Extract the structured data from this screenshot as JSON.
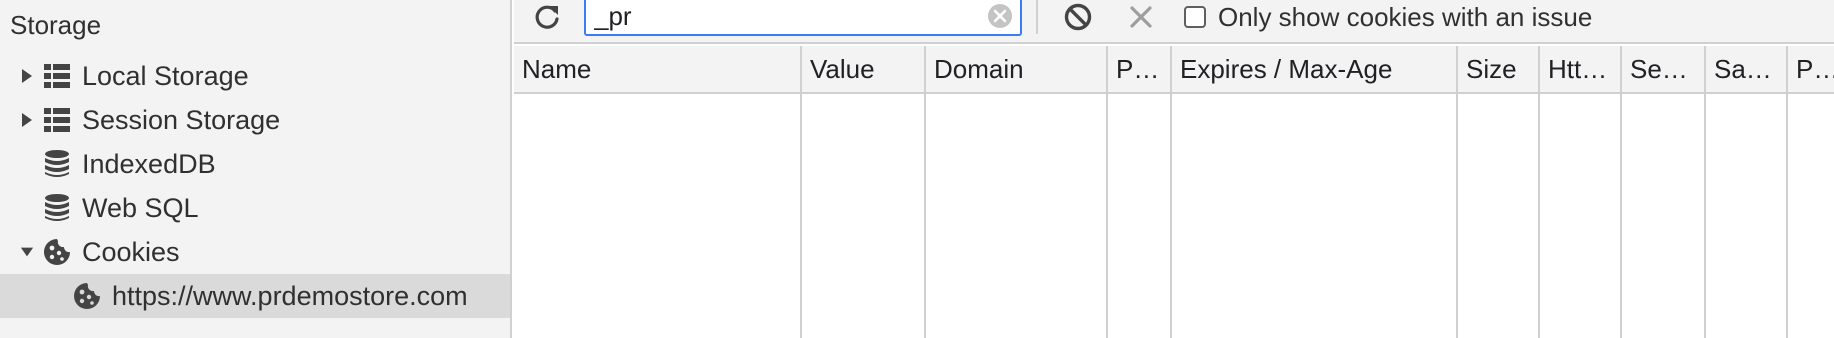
{
  "sidebar": {
    "title": "Storage",
    "items": [
      {
        "label": "Local Storage"
      },
      {
        "label": "Session Storage"
      },
      {
        "label": "IndexedDB"
      },
      {
        "label": "Web SQL"
      },
      {
        "label": "Cookies"
      },
      {
        "label": "https://www.prdemostore.com",
        "selected": true
      }
    ]
  },
  "toolbar": {
    "filter_value": "_pr",
    "issue_checkbox_label": "Only show cookies with an issue",
    "issue_checkbox_checked": false
  },
  "table": {
    "columns": [
      "Name",
      "Value",
      "Domain",
      "P…",
      "Expires / Max-Age",
      "Size",
      "Htt…",
      "Se…",
      "Sa…",
      "Pri"
    ],
    "rows": []
  },
  "colors": {
    "focus_border": "#3b7cf0",
    "panel_bg": "#f3f3f3",
    "selected_row_bg": "#dadada"
  }
}
